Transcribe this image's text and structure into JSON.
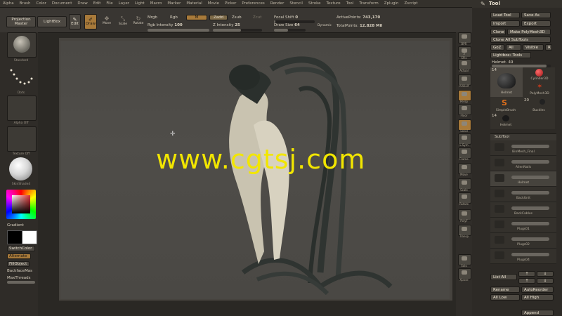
{
  "menu": [
    "Alpha",
    "Brush",
    "Color",
    "Document",
    "Draw",
    "Edit",
    "File",
    "Layer",
    "Light",
    "Macro",
    "Marker",
    "Material",
    "Movie",
    "Picker",
    "Preferences",
    "Render",
    "Stencil",
    "Stroke",
    "Texture",
    "Tool",
    "Transform",
    "Zplugin",
    "Zscript"
  ],
  "tool_title": "Tool",
  "shelf": {
    "projection_master": "Projection Master",
    "lightbox": "LightBox",
    "edit": "Edit",
    "draw": "Draw",
    "move": "Move",
    "scale": "Scale",
    "rotate": "Rotate",
    "mrgb": "Mrgb",
    "rgb": "Rgb",
    "m": "M",
    "zadd": "Zadd",
    "zsub": "Zsub",
    "zcut": "Zcut",
    "rgb_intensity_label": "Rgb Intensity",
    "rgb_intensity_value": "100",
    "z_intensity_label": "Z Intensity",
    "z_intensity_value": "25",
    "focal_shift_label": "Focal Shift",
    "focal_shift_value": "0",
    "draw_size_label": "Draw Size",
    "draw_size_value": "64",
    "dynamic": "Dynamic",
    "active_points_label": "ActivePoints:",
    "active_points_value": "743,170",
    "total_points_label": "TotalPoints:",
    "total_points_value": "12.828 Mil"
  },
  "left_tray": {
    "standard": "Standard",
    "dots": "Dots",
    "alpha_off": "Alpha Off",
    "texture_off": "Texture Off",
    "skinshade": "SkinShade4",
    "gradient": "Gradient",
    "switch_color": "SwitchColor",
    "alternate": "Alternate",
    "fill_object": "FillObject",
    "backface_mask": "BackfaceMas",
    "max_threads": "MaxThreads"
  },
  "right_toolbar": [
    "BPR",
    "SPix",
    "Actual",
    "AAHalf",
    "Persp",
    "Floor",
    "Local",
    "L.Sym",
    "Frame",
    "Move",
    "Scale",
    "Rotate",
    "PolyF",
    "Transp",
    "Solo",
    "Xpose"
  ],
  "right_toolbar_values": {
    "spix": "3"
  },
  "tool_panel": {
    "load_tool": "Load Tool",
    "save_as": "Save As",
    "import": "Import",
    "export": "Export",
    "clone": "Clone",
    "make_polymesh": "Make PolyMesh3D",
    "clone_all_subtools": "Clone All SubTools",
    "goz": "GoZ",
    "all": "All",
    "visible": "Visible",
    "r": "R",
    "lightbox_tools": "Lightbox› Tools",
    "current_tool": "Helmet. 49",
    "tool_count_1": "14",
    "tool_thumb_1": "Helmet",
    "tool_thumb_2": "Cylinder3D",
    "tool_thumb_3": "PolyMesh3D",
    "tool_count_2": "20",
    "tool_thumb_4": "SimpleBrush",
    "tool_thumb_5": "Buckles",
    "tool_count_3": "14",
    "tool_thumb_6": "Helmet"
  },
  "subtool": {
    "title": "SubTool",
    "items": [
      "BinMesh_Final",
      "AlienNails",
      "Helmet",
      "BackUnit",
      "BackCables",
      "Plugs01",
      "Plugs02",
      "Plugs04"
    ],
    "list_all": "List All",
    "rename": "Rename",
    "auto_reorder": "AutoReorder",
    "all_low": "All Low",
    "all_high": "All High",
    "append": "Append"
  },
  "watermark": "www.cgtsj.com",
  "colors": {
    "accent": "#a87a3a",
    "watermark": "#f2e600"
  }
}
